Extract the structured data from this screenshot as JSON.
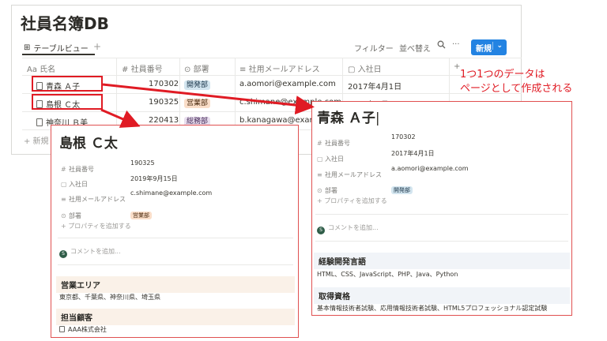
{
  "database": {
    "title": "社員名簿DB",
    "view_tab": "テーブルビュー",
    "add_view": "+",
    "toolbar": {
      "filter": "フィルター",
      "sort": "並べ替え",
      "search_icon": "search-icon",
      "more": "···",
      "new_label": "新規",
      "new_dropdown": "⌄"
    },
    "columns": [
      {
        "icon": "Aa",
        "label": "氏名"
      },
      {
        "icon": "#",
        "label": "社員番号"
      },
      {
        "icon": "⊙",
        "label": "部署"
      },
      {
        "icon": "≡",
        "label": "社用メールアドレス"
      },
      {
        "icon": "▢",
        "label": "入社日"
      },
      {
        "icon": "+",
        "label": ""
      }
    ],
    "rows": [
      {
        "name": "青森 Ａ子",
        "number": "170302",
        "dept": "開発部",
        "email": "a.aomori@example.com",
        "date": "2017年4月1日"
      },
      {
        "name": "島根 Ｃ太",
        "number": "190325",
        "dept": "営業部",
        "email": "c.shimane@example.com",
        "date": "2019年9月15日"
      },
      {
        "name": "神奈川 Ｂ美",
        "number": "220413",
        "dept": "総務部",
        "email": "b.kanagawa@example.com",
        "date": ""
      }
    ],
    "new_row": "+ 新規"
  },
  "annotation": {
    "line1": "1つ1つのデータは",
    "line2": "ページとして作成される"
  },
  "card_shimane": {
    "title": "島根 Ｃ太",
    "props": [
      {
        "icon": "#",
        "label": "社員番号",
        "value": "190325"
      },
      {
        "icon": "▢",
        "label": "入社日",
        "value": "2019年9月15日"
      },
      {
        "icon": "≡",
        "label": "社用メールアドレス",
        "value": "c.shimane@example.com"
      },
      {
        "icon": "⊙",
        "label": "部署",
        "value": "営業部"
      }
    ],
    "add_prop": "+ プロパティを追加する",
    "comment": "コメントを追加...",
    "comment_avatar": "S",
    "section1_title": "営業エリア",
    "section1_body": "東京都、千葉県、神奈川県、埼玉県",
    "section2_title": "担当顧客",
    "section2_body": "AAA株式会社"
  },
  "card_aomori": {
    "title": "青森 Ａ子",
    "props": [
      {
        "icon": "#",
        "label": "社員番号",
        "value": "170302"
      },
      {
        "icon": "▢",
        "label": "入社日",
        "value": "2017年4月1日"
      },
      {
        "icon": "≡",
        "label": "社用メールアドレス",
        "value": "a.aomori@example.com"
      },
      {
        "icon": "⊙",
        "label": "部署",
        "value": "開発部"
      }
    ],
    "add_prop": "+ プロパティを追加する",
    "comment": "コメントを追加...",
    "comment_avatar": "S",
    "section1_title": "経験開発言語",
    "section1_body": "HTML、CSS、JavaScript、PHP、Java、Python",
    "section2_title": "取得資格",
    "section2_body": "基本情報技術者試験、応用情報技術者試験、HTML5プロフェッショナル認定試験"
  },
  "colors": {
    "accent": "#2383e2",
    "highlight": "#e01b24"
  }
}
